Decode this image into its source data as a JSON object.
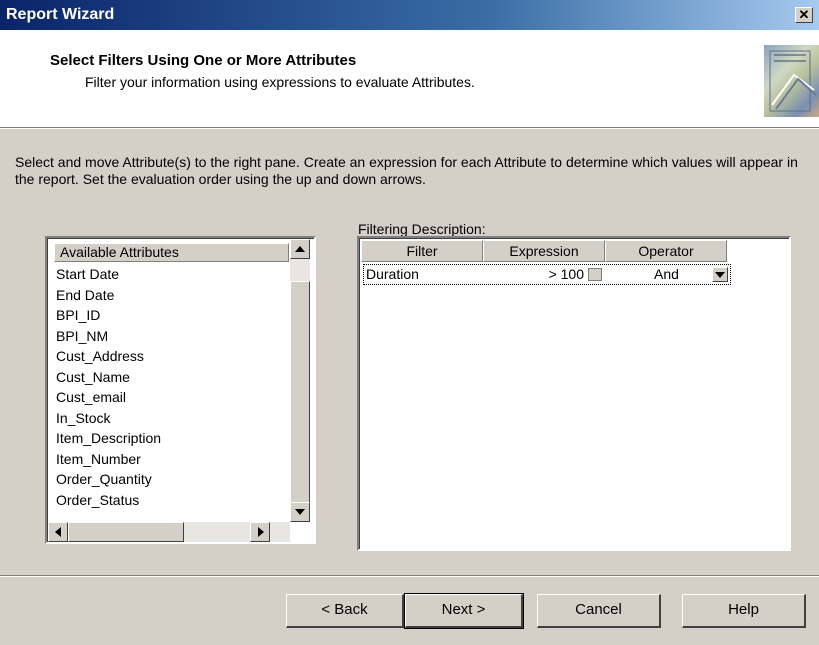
{
  "window": {
    "title": "Report Wizard",
    "close_glyph": "✕"
  },
  "header": {
    "title": "Select Filters Using One or More Attributes",
    "subtitle": "Filter your information using expressions to evaluate Attributes."
  },
  "instructions": "Select and move Attribute(s) to the right pane.  Create an expression for each Attribute to determine which values will appear in the report.  Set the evaluation order using the up and down arrows.",
  "filtering_caption": "Filtering Description:",
  "available": {
    "header": "Available Attributes",
    "items": [
      "Start Date",
      "End Date",
      "BPI_ID",
      "BPI_NM",
      "Cust_Address",
      "Cust_Name",
      "Cust_email",
      "In_Stock",
      "Item_Description",
      "Item_Number",
      "Order_Quantity",
      "Order_Status"
    ]
  },
  "grid": {
    "columns": [
      "Filter",
      "Expression",
      "Operator"
    ],
    "rows": [
      {
        "filter": "Duration",
        "expression": "> 100",
        "operator": "And"
      }
    ]
  },
  "buttons": {
    "back": "< Back",
    "next": "Next >",
    "cancel": "Cancel",
    "help": "Help"
  },
  "colors": {
    "titlebar_start": "#0a246a",
    "titlebar_end": "#a6caf0",
    "dialog_bg": "#d4d0c8"
  }
}
